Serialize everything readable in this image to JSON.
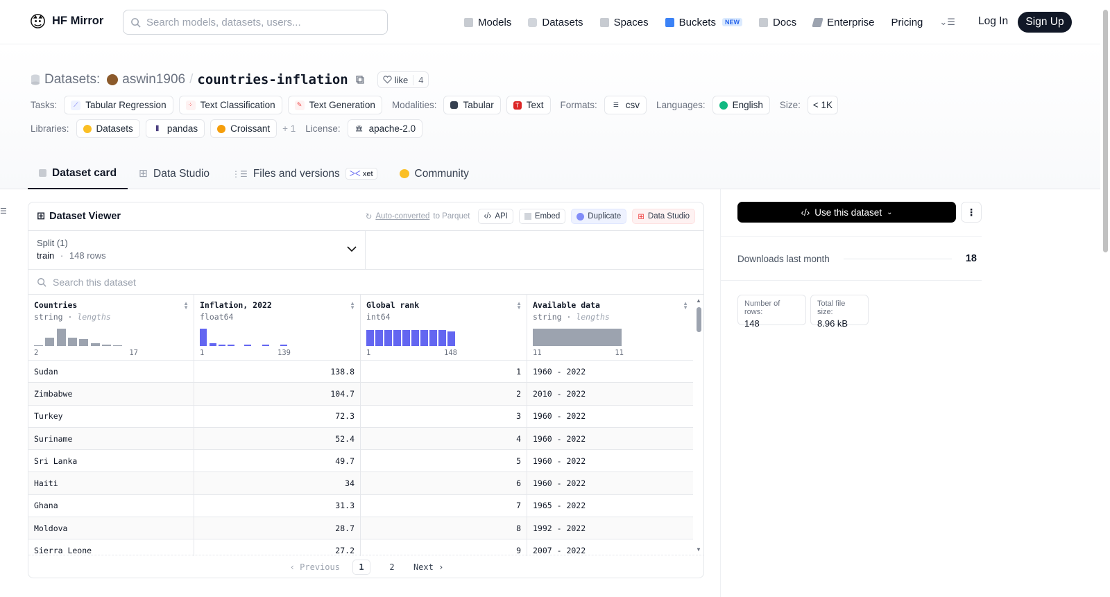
{
  "nav": {
    "brand": "HF Mirror",
    "search_placeholder": "Search models, datasets, users...",
    "links": [
      "Models",
      "Datasets",
      "Spaces",
      "Buckets",
      "Docs",
      "Enterprise",
      "Pricing"
    ],
    "buckets_badge": "NEW",
    "login": "Log In",
    "signup": "Sign Up"
  },
  "repo": {
    "section": "Datasets:",
    "owner": "aswin1906",
    "sep": "/",
    "name": "countries-inflation",
    "like_label": "like",
    "like_count": "4"
  },
  "tags": {
    "tasks_label": "Tasks:",
    "tasks": [
      "Tabular Regression",
      "Text Classification",
      "Text Generation"
    ],
    "modalities_label": "Modalities:",
    "modalities": [
      "Tabular",
      "Text"
    ],
    "formats_label": "Formats:",
    "formats": [
      "csv"
    ],
    "languages_label": "Languages:",
    "languages": [
      "English"
    ],
    "size_label": "Size:",
    "size": "< 1K",
    "libraries_label": "Libraries:",
    "libraries": [
      "Datasets",
      "pandas",
      "Croissant"
    ],
    "libraries_more": "+ 1",
    "license_label": "License:",
    "license": "apache-2.0"
  },
  "tabs": {
    "dataset_card": "Dataset card",
    "data_studio": "Data Studio",
    "files": "Files and versions",
    "xet": "xet",
    "community": "Community"
  },
  "viewer": {
    "title": "Dataset Viewer",
    "auto_converted": "Auto-converted",
    "to_parquet": "to Parquet",
    "api": "API",
    "embed": "Embed",
    "duplicate": "Duplicate",
    "data_studio": "Data Studio",
    "split_label": "Split (1)",
    "split_name": "train",
    "split_dot": "·",
    "split_rows": "148 rows",
    "search_placeholder": "Search this dataset",
    "columns": [
      {
        "name": "Countries",
        "type": "string",
        "type_note": "lengths",
        "min": "2",
        "max": "17"
      },
      {
        "name": "Inflation, 2022",
        "type": "float64",
        "type_note": "",
        "min": "1",
        "max": "139"
      },
      {
        "name": "Global rank",
        "type": "int64",
        "type_note": "",
        "min": "1",
        "max": "148"
      },
      {
        "name": "Available data",
        "type": "string",
        "type_note": "lengths",
        "min": "11",
        "max": "11"
      }
    ],
    "rows": [
      [
        "Sudan",
        "138.8",
        "1",
        "1960 - 2022"
      ],
      [
        "Zimbabwe",
        "104.7",
        "2",
        "2010 - 2022"
      ],
      [
        "Turkey",
        "72.3",
        "3",
        "1960 - 2022"
      ],
      [
        "Suriname",
        "52.4",
        "4",
        "1960 - 2022"
      ],
      [
        "Sri Lanka",
        "49.7",
        "5",
        "1960 - 2022"
      ],
      [
        "Haiti",
        "34",
        "6",
        "1960 - 2022"
      ],
      [
        "Ghana",
        "31.3",
        "7",
        "1965 - 2022"
      ],
      [
        "Moldova",
        "28.7",
        "8",
        "1992 - 2022"
      ],
      [
        "Sierra Leone",
        "27.2",
        "9",
        "2007 - 2022"
      ]
    ],
    "pager": {
      "prev": "Previous",
      "pages": [
        "1",
        "2"
      ],
      "next": "Next"
    }
  },
  "side": {
    "use_dataset": "Use this dataset",
    "downloads_label": "Downloads last month",
    "downloads_value": "18",
    "rows_label": "Number of rows:",
    "rows_value": "148",
    "size_label": "Total file size:",
    "size_value": "8.96 kB"
  },
  "colors": {
    "accent": "#6366f1",
    "hist_gray": "#9ca3af",
    "dark": "#111827"
  }
}
